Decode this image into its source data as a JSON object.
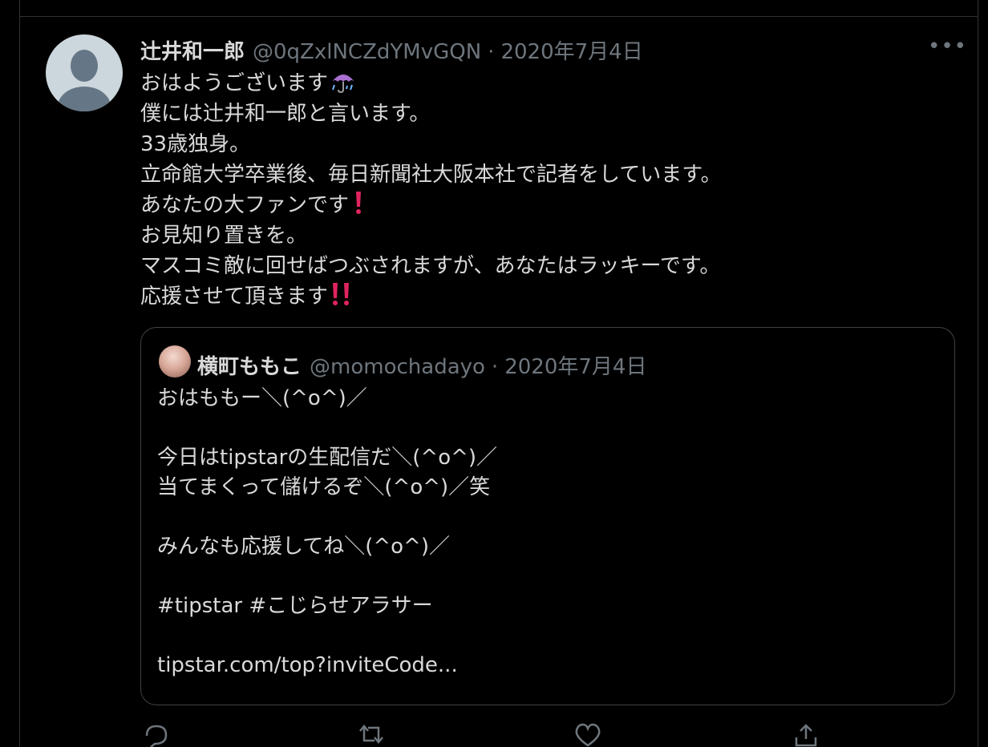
{
  "tweet": {
    "author_name": "辻井和一郎",
    "author_handle": "@0qZxlNCZdYMvGQN",
    "separator": "·",
    "date": "2020年7月4日",
    "more_label": "•••",
    "lines": [
      "おはようございます",
      "僕には辻井和一郎と言います。",
      "33歳独身。",
      "立命館大学卒業後、毎日新聞社大阪本社で記者をしています。",
      "あなたの大ファンです",
      "お見知り置きを。",
      "マスコミ敵に回せばつぶされますが、あなたはラッキーです。",
      "応援させて頂きます"
    ],
    "icons": {
      "umbrella": "umbrella-rain-icon",
      "exclamation": "red-exclamation-icon",
      "double_exclamation": "red-double-exclamation-icon"
    }
  },
  "quoted_tweet": {
    "author_name": "横町ももこ",
    "author_handle": "@momochadayo",
    "separator": "·",
    "date": "2020年7月4日",
    "lines": [
      "おはももー＼(^o^)／",
      "",
      "今日はtipstarの生配信だ＼(^o^)／",
      "当てまくって儲けるぞ＼(^o^)／笑",
      "",
      "みんなも応援してね＼(^o^)／",
      "",
      "#tipstar #こじらせアラサー",
      "",
      "tipstar.com/top?inviteCode..."
    ]
  },
  "actions": [
    "reply-icon",
    "retweet-icon",
    "like-icon",
    "share-icon"
  ],
  "colors": {
    "background": "#000000",
    "text": "#d9d9d9",
    "secondary": "#6e767d",
    "border": "#2f3336",
    "emoji_red": "#e0245e"
  }
}
